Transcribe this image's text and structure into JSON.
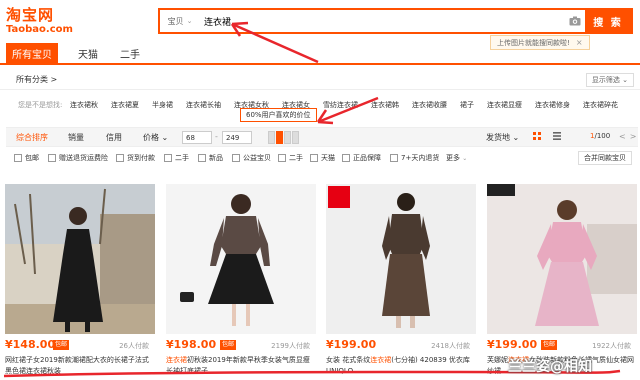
{
  "header": {
    "logo_cn": "淘宝网",
    "logo_en": "Taobao.com",
    "search_type": "宝贝",
    "search_value": "连衣裙",
    "search_button": "搜 索",
    "image_search_tip": "上传图片就能搜同款啦!"
  },
  "nav": {
    "tabs": [
      "所有宝贝",
      "天猫",
      "二手"
    ],
    "active": "所有宝贝"
  },
  "category": {
    "all_label": "所有分类 >",
    "filter_button": "显示筛选 ⌄"
  },
  "suggestions": {
    "label": "您是不是想找:",
    "items": [
      "连衣裙秋",
      "连衣裙夏",
      "半身裙",
      "连衣裙长袖",
      "连衣裙女秋",
      "连衣裙女",
      "雪纺连衣裙",
      "连衣裙韩",
      "连衣裙收腰",
      "裙子",
      "连衣裙显瘦",
      "连衣裙修身",
      "连衣裙碎花"
    ]
  },
  "sort_bar": {
    "items": [
      "综合排序",
      "销量",
      "信用",
      "价格"
    ],
    "active": "综合排序",
    "price_min": "68",
    "price_max": "249",
    "price_tip": "60%用户喜欢的价位",
    "ship_from": "发货地",
    "page_current": "1",
    "page_total": "/100"
  },
  "filters": {
    "checkboxes": [
      "包邮",
      "赠送退货运费险",
      "货到付款",
      "二手",
      "新品",
      "公益宝贝",
      "二手",
      "天猫",
      "正品保障",
      "7+天内退货"
    ],
    "more": "更多",
    "merge_button": "合并同款宝贝"
  },
  "products": [
    {
      "price": "¥148.00",
      "badge": "包邮",
      "sold": "26人付款",
      "title_pre": "",
      "title_hl": "",
      "title_post": "网红裙子女2019新款潮裙配大衣的长裙子法式黑色裙连衣裙秋装"
    },
    {
      "price": "¥198.00",
      "badge": "包邮",
      "sold": "2199人付款",
      "title_pre": "",
      "title_hl": "连衣裙",
      "title_post": "初秋装2019年新款早秋季女装气质显瘦长袖打底裙子"
    },
    {
      "price": "¥199.00",
      "badge": "",
      "sold": "2418人付款",
      "title_pre": "女装 花式条纹",
      "title_hl": "连衣裙",
      "title_post": "(七分袖) 420839 优衣库UNIQLO"
    },
    {
      "price": "¥199.00",
      "badge": "包邮",
      "sold": "1922人付款",
      "title_pre": "芙娜妮",
      "title_hl": "连衣裙",
      "title_post": "女秋装新款粉色长裙气质仙女裙网纱裙"
    }
  ],
  "watermark": "兰兰姿@相知",
  "colors": {
    "accent": "#ff5000",
    "annotation": "#e8262c"
  }
}
